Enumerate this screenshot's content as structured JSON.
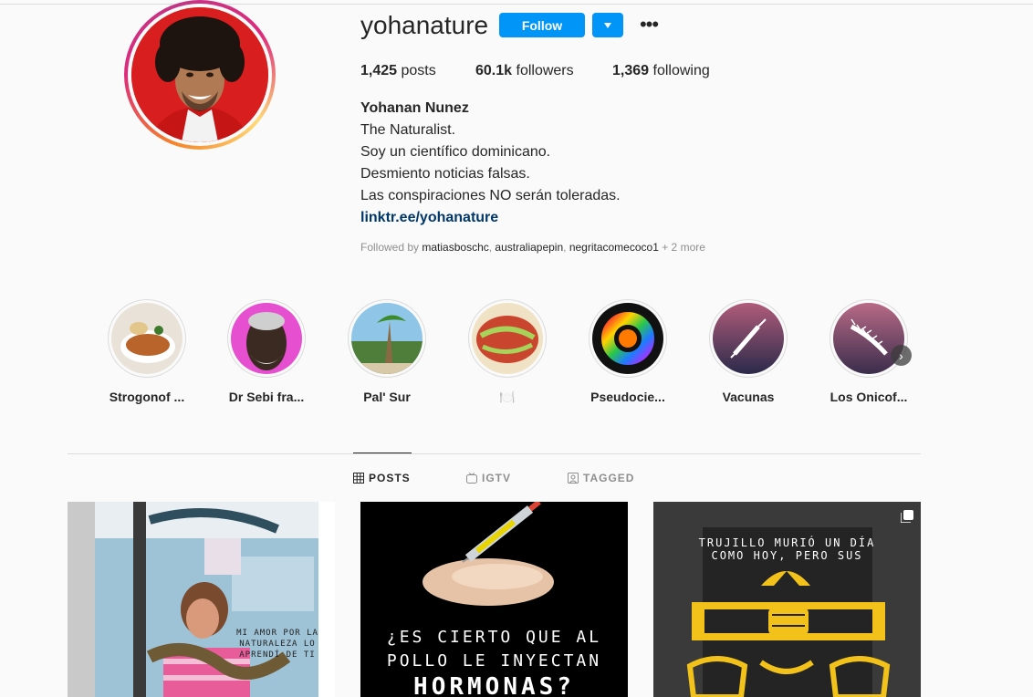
{
  "profile": {
    "username": "yohanature",
    "follow_label": "Follow",
    "more_label": "•••"
  },
  "stats": {
    "posts_count": "1,425",
    "posts_label": "posts",
    "followers_count": "60.1k",
    "followers_label": "followers",
    "following_count": "1,369",
    "following_label": "following"
  },
  "bio": {
    "name": "Yohanan Nunez",
    "lines": [
      "The Naturalist.",
      "Soy un científico dominicano.",
      "Desmiento noticias falsas.",
      "Las conspiraciones NO serán toleradas."
    ],
    "link": "linktr.ee/yohanature",
    "followed_by_prefix": "Followed by",
    "followed_by_users": [
      "matiasboschc",
      "australiapepin",
      "negritacomecoco1"
    ],
    "followed_by_more": "+ 2 more"
  },
  "highlights": [
    {
      "label": "Strogonof ..."
    },
    {
      "label": "Dr Sebi fra..."
    },
    {
      "label": "Pal' Sur"
    },
    {
      "label": "🍽️"
    },
    {
      "label": "Pseudocie..."
    },
    {
      "label": "Vacunas"
    },
    {
      "label": "Los Onicof..."
    }
  ],
  "tabs": {
    "posts": "POSTS",
    "igtv": "IGTV",
    "tagged": "TAGGED"
  },
  "posts": {
    "p1_caption": "MI AMOR POR LA NATURALEZA LO APRENDÍ DE TI",
    "p2_line1": "¿ES CIERTO QUE AL",
    "p2_line2": "POLLO LE INYECTAN",
    "p2_line3": "HORMONAS?",
    "p3_line1": "TRUJILLO MURIÓ UN DÍA",
    "p3_line2": "COMO HOY, PERO SUS"
  },
  "colors": {
    "accent": "#0095f6",
    "link": "#00376b",
    "muted": "#8e8e8e"
  }
}
